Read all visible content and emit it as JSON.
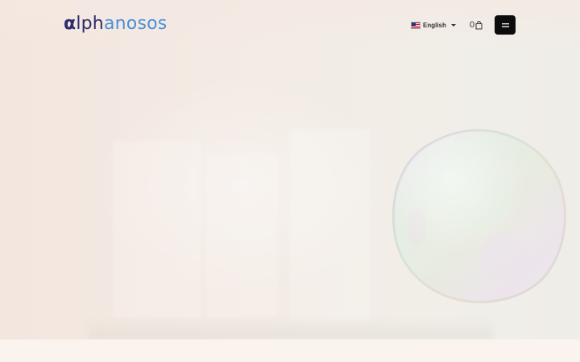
{
  "header": {
    "logo": {
      "alpha": "α",
      "lph": "lph",
      "rest": "anosos"
    },
    "language": {
      "flag_icon": "us-flag-icon",
      "label": "English",
      "caret_icon": "caret-down-icon"
    },
    "cart": {
      "count": "0",
      "icon": "shopping-bag-icon"
    },
    "menu": {
      "icon": "hamburger-menu-icon"
    }
  },
  "hero": {
    "decoration": "iridescent-bubble"
  },
  "colors": {
    "logo_dark": "#2e2c6b",
    "logo_light": "#4a8fd8",
    "menu_button_bg": "#0c0c0c",
    "hero_bg": "#f3ebe4"
  }
}
